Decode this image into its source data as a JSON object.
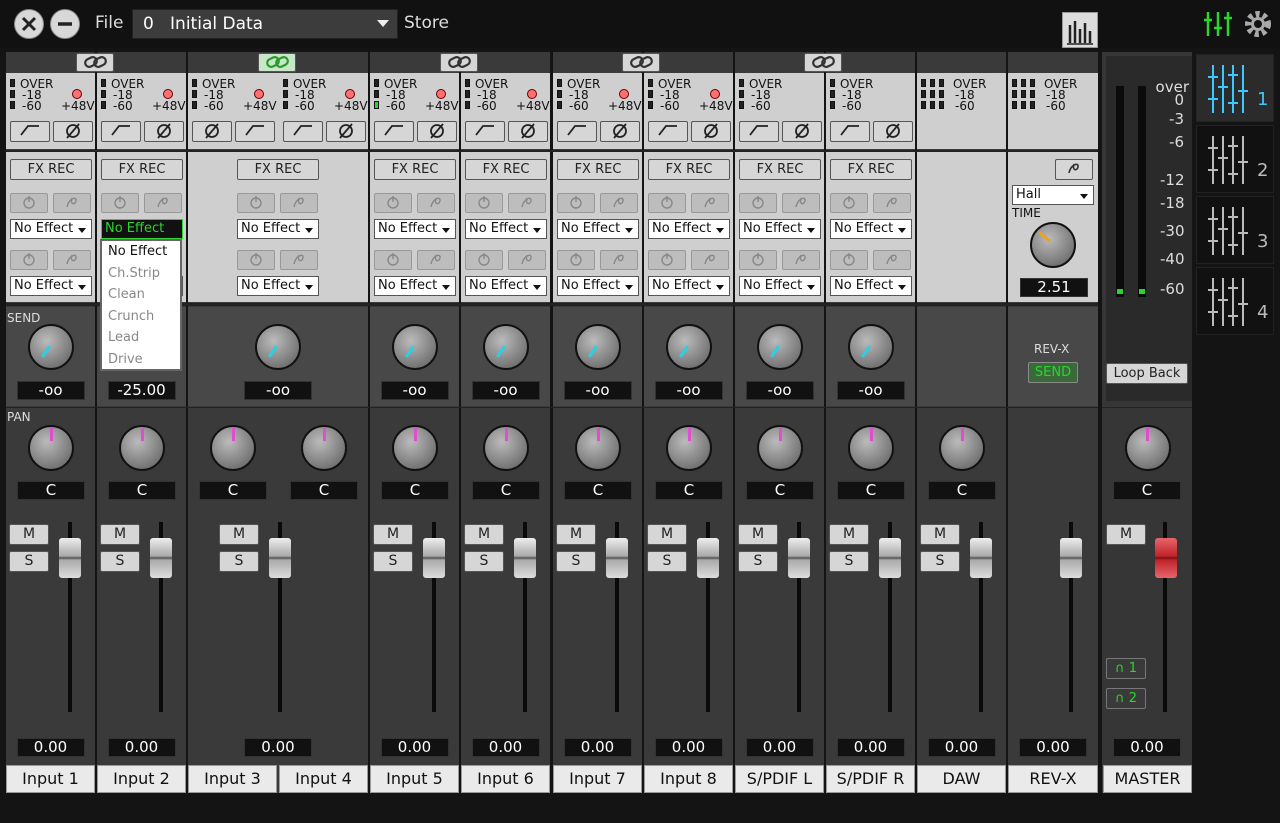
{
  "header": {
    "file_label": "File",
    "scene_number": "0",
    "scene_name": "Initial Data",
    "store_label": "Store"
  },
  "meter": {
    "over": "OVER",
    "m18": "-18",
    "m60": "-60",
    "phantom": "+48V"
  },
  "labels": {
    "fx_rec": "FX REC",
    "send": "SEND",
    "pan": "PAN",
    "mute": "M",
    "solo": "S"
  },
  "effect_default": "No Effect",
  "effect_options": [
    "No Effect",
    "Ch.Strip",
    "Clean",
    "Crunch",
    "Lead",
    "Drive"
  ],
  "channels": [
    {
      "name": "Input 1",
      "send": "-oo",
      "pan": "C",
      "fader": "0.00"
    },
    {
      "name": "Input 2",
      "send": "-25.00",
      "pan": "C",
      "fader": "0.00"
    },
    {
      "name": "Input 3",
      "pan": "C"
    },
    {
      "name": "Input 4",
      "pan": "C"
    },
    {
      "name": "Input 5",
      "send": "-oo",
      "pan": "C",
      "fader": "0.00"
    },
    {
      "name": "Input 6",
      "send": "-oo",
      "pan": "C",
      "fader": "0.00"
    },
    {
      "name": "Input 7",
      "send": "-oo",
      "pan": "C",
      "fader": "0.00"
    },
    {
      "name": "Input 8",
      "send": "-oo",
      "pan": "C",
      "fader": "0.00"
    },
    {
      "name": "S/PDIF L",
      "send": "-oo",
      "pan": "C",
      "fader": "0.00"
    },
    {
      "name": "S/PDIF R",
      "send": "-oo",
      "pan": "C",
      "fader": "0.00"
    },
    {
      "name": "DAW",
      "pan": "C",
      "fader": "0.00"
    },
    {
      "name": "REV-X",
      "fader": "0.00"
    }
  ],
  "stereo34": {
    "send": "-oo",
    "fader": "0.00"
  },
  "reverb": {
    "type": "Hall",
    "time_label": "TIME",
    "time_value": "2.51",
    "name": "REV-X",
    "send_label": "SEND"
  },
  "master": {
    "name": "MASTER",
    "pan": "C",
    "fader": "0.00",
    "loopback": "Loop Back",
    "phones1": "1",
    "phones2": "2",
    "scale": [
      "over",
      "0",
      "-3",
      "-6",
      "-12",
      "-18",
      "-30",
      "-40",
      "-60"
    ]
  },
  "tabs": [
    "1",
    "2",
    "3",
    "4"
  ],
  "colors": {
    "accent": "#3cc8ff",
    "green": "#2bd52b",
    "pan_indicator": "#e04ed0",
    "send_indicator": "#2ad0e8",
    "master_fader": "#c0232b"
  }
}
